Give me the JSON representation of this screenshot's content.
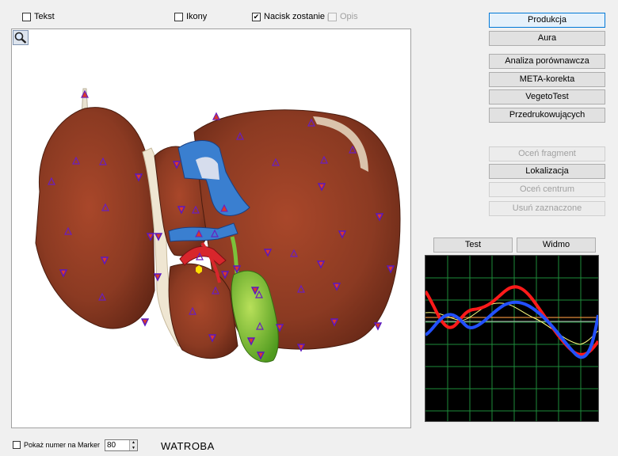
{
  "top_checkboxes": [
    {
      "label": "Tekst",
      "checked": false,
      "enabled": true
    },
    {
      "label": "Ikony",
      "checked": false,
      "enabled": true
    },
    {
      "label": "Nacisk zostanie p",
      "checked": true,
      "enabled": true
    },
    {
      "label": "Opis",
      "checked": false,
      "enabled": false
    }
  ],
  "buttons": {
    "produkcja": "Produkcja",
    "aura": "Aura",
    "analiza": "Analiza porównawcza",
    "meta": "META-korekta",
    "vegeto": "VegetoTest",
    "przedruk": "Przedrukowujących",
    "ocen_fragment": "Oceń fragment",
    "lokalizacja": "Lokalizacja",
    "ocen_centrum": "Oceń centrum",
    "usun": "Usuń zaznaczone",
    "test": "Test",
    "widmo": "Widmo"
  },
  "bottom": {
    "marker_checkbox_label": "Pokaż numer na Marker",
    "marker_checked": false,
    "spin_value": "80",
    "organ_name": "WATROBA"
  },
  "colors": {
    "accent": "#0078d7",
    "liver": "#8b3a22",
    "gallbladder": "#7cc13a",
    "vein": "#3a7fd0",
    "artery": "#d8262c",
    "marker_stroke": "#6a1fbf",
    "marker_fill": "#d93a2a",
    "grid": "#1e8c3a",
    "curve_red": "#ff1a1a",
    "curve_blue": "#2250ff",
    "curve_yellow": "#ffff80"
  },
  "icons": {
    "zoom": "magnifier-icon"
  }
}
